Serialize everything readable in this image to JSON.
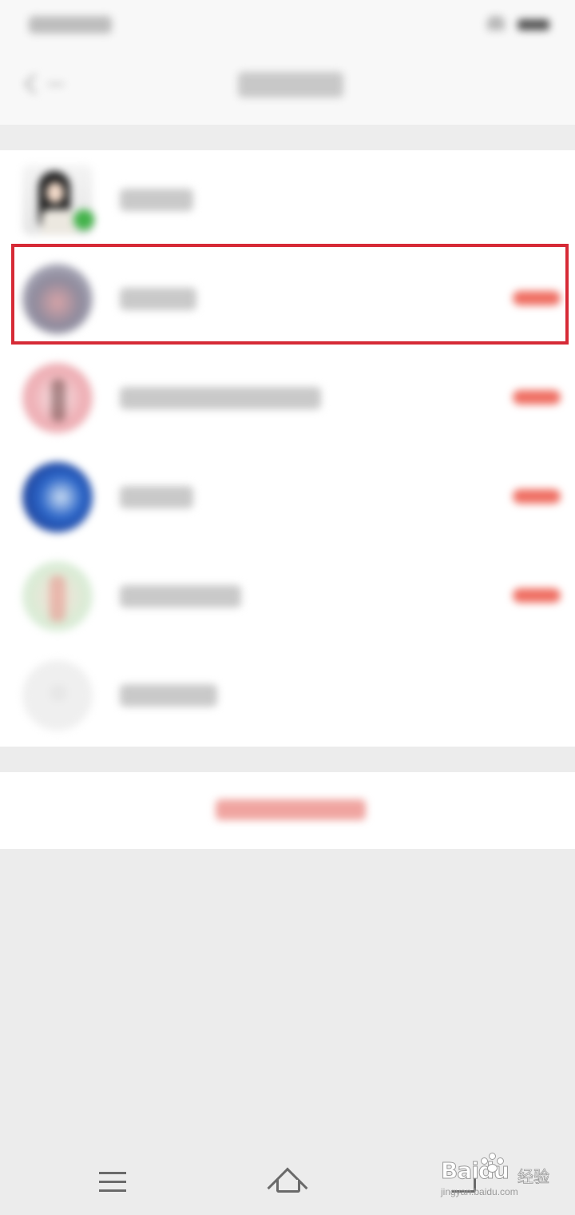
{
  "status_bar": {
    "carrier_text": "",
    "wifi_icon": "wifi-icon",
    "battery_icon": "battery-icon"
  },
  "nav_bar": {
    "back_icon": "back-arrow-icon",
    "title": ""
  },
  "account_list": {
    "items": [
      {
        "name": "",
        "avatar": "avatar-woman-photo",
        "has_wechat_badge": true,
        "has_status_badge": false,
        "highlighted": false
      },
      {
        "name": "",
        "avatar": "avatar-pink-round",
        "has_wechat_badge": false,
        "has_status_badge": true,
        "highlighted": true
      },
      {
        "name": "",
        "avatar": "avatar-pink-figure",
        "has_wechat_badge": false,
        "has_status_badge": true,
        "highlighted": false
      },
      {
        "name": "",
        "avatar": "avatar-blue-round",
        "has_wechat_badge": false,
        "has_status_badge": true,
        "highlighted": false
      },
      {
        "name": "",
        "avatar": "avatar-green-figure",
        "has_wechat_badge": false,
        "has_status_badge": true,
        "highlighted": false
      },
      {
        "name": "",
        "avatar": "add-account-icon",
        "has_wechat_badge": false,
        "has_status_badge": false,
        "highlighted": false
      }
    ],
    "badge_color": "#ef6e62",
    "highlight_color": "#d62a36"
  },
  "bottom_action": {
    "label": "",
    "color": "#f0a4a0"
  },
  "system_nav": {
    "menu_icon": "menu-icon",
    "home_icon": "home-icon",
    "back_icon": "back-nav-icon"
  },
  "watermark": {
    "logo": "Bai",
    "logo_suffix": "du",
    "chinese": "经验",
    "url": "jingyan.baidu.com"
  }
}
